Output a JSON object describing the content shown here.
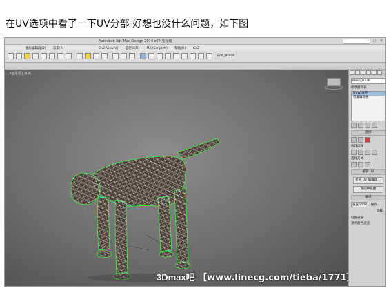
{
  "caption": "在UV选项中看了一下UV分部 好想也没什么问题，如下图",
  "app": {
    "title": "Autodesk 3ds Max Design 2014 x64    无标题",
    "menus": [
      "图形编辑器(D)",
      "渲染(R)",
      "Civil View(V)",
      "自定义(U)",
      "MAXScript(M)",
      "帮助(H)",
      "GoZ"
    ],
    "toolbar_label": "Edit_NORM",
    "window_buttons": "– □ ×"
  },
  "viewport": {
    "label": "[+][透视][真实]"
  },
  "command_panel": {
    "object_name": "Mesh_0336",
    "modifier_list_label": "修改器列表",
    "stack": [
      {
        "label": "UVW 展开",
        "selected": true
      },
      {
        "label": "可编辑网格",
        "selected": false
      }
    ],
    "sections": {
      "selection": "选择",
      "modify_selection": "修改选择",
      "selection_method": "选择方式",
      "edit_uv": "编辑 UV",
      "open_uv_editor": "打开 UV 编辑器 ...",
      "view_align": "视图中扭曲",
      "channel": "通道",
      "reset_uvw": "重置 UVW",
      "save": "保存...",
      "load": "加载...",
      "map_channel": "贴图通道:",
      "vertex_color_channel": "顶点颜色通道"
    }
  },
  "watermark": {
    "brand": "3Dmax吧",
    "url": "【www.linecg.com/tieba/1771】"
  },
  "colors": {
    "viewport_bg": "#6d6d6d",
    "wire": "#dcdcdc",
    "selection_edge": "#3ddc3d",
    "accent": "#9bbbe0"
  }
}
